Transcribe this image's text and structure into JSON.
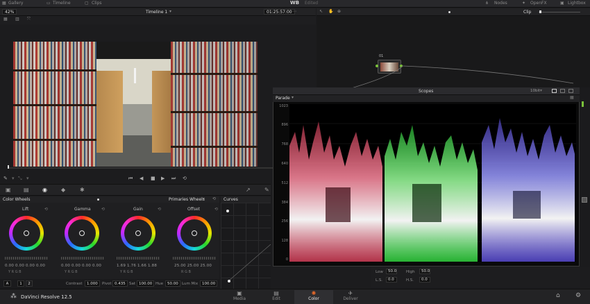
{
  "topbar": {
    "gallery": "Gallery",
    "timeline": "Timeline",
    "clips": "Clips",
    "wb": "WB",
    "edited": "Edited",
    "nodes": "Nodes",
    "openfx": "OpenFX",
    "lightbox": "Lightbox"
  },
  "viewer": {
    "zoom": "42%",
    "timeline_name": "Timeline 1",
    "timecode": "01:25:57:00"
  },
  "node_editor": {
    "mode": "Clip",
    "node_number": "01"
  },
  "playback": {
    "buttons": [
      "⏮",
      "◀",
      "■",
      "▶",
      "⏭",
      "⟲"
    ]
  },
  "color_wheels": {
    "title": "Color Wheels",
    "mode": "Primaries Wheels",
    "wheels": [
      {
        "label": "Lift",
        "values": "0.00  0.00  0.00  0.00"
      },
      {
        "label": "Gamma",
        "values": "0.00  0.00  0.00  0.00"
      },
      {
        "label": "Gain",
        "values": "1.69  1.76  1.66  1.88"
      },
      {
        "label": "Offset",
        "values": "25.00  25.00  25.00"
      }
    ],
    "channel_labels_4": "Y  R  G  B",
    "channel_labels_3": "R  G  B",
    "footer": {
      "a_label": "A",
      "page1": "1",
      "page2": "2",
      "contrast_label": "Contrast",
      "contrast": "1.000",
      "pivot_label": "Pivot",
      "pivot": "0.435",
      "sat_label": "Sat",
      "sat": "100.00",
      "hue_label": "Hue",
      "hue": "50.00",
      "lummix_label": "Lum Mix",
      "lummix": "100.00"
    }
  },
  "curves": {
    "title": "Curves"
  },
  "scopes": {
    "title": "Scopes",
    "type": "Parade",
    "bit_depth": "10bit",
    "axis_ticks": [
      "1023",
      "896",
      "768",
      "640",
      "512",
      "384",
      "256",
      "128",
      "0"
    ],
    "channel_colors": {
      "red": "#ff4a6a",
      "green": "#3aff4a",
      "blue": "#6a5aff"
    }
  },
  "lower_right": {
    "low_label": "Low",
    "low": "50.0",
    "high_label": "High",
    "high": "50.0",
    "ls_label": "L.S.",
    "ls": "0.0",
    "hs_label": "H.S.",
    "hs": "0.0"
  },
  "app": {
    "name": "DaVinci Resolve 12.5"
  },
  "pages": [
    {
      "label": "Media",
      "icon": "▣"
    },
    {
      "label": "Edit",
      "icon": "▤"
    },
    {
      "label": "Color",
      "icon": "✺"
    },
    {
      "label": "Deliver",
      "icon": "✈"
    }
  ]
}
